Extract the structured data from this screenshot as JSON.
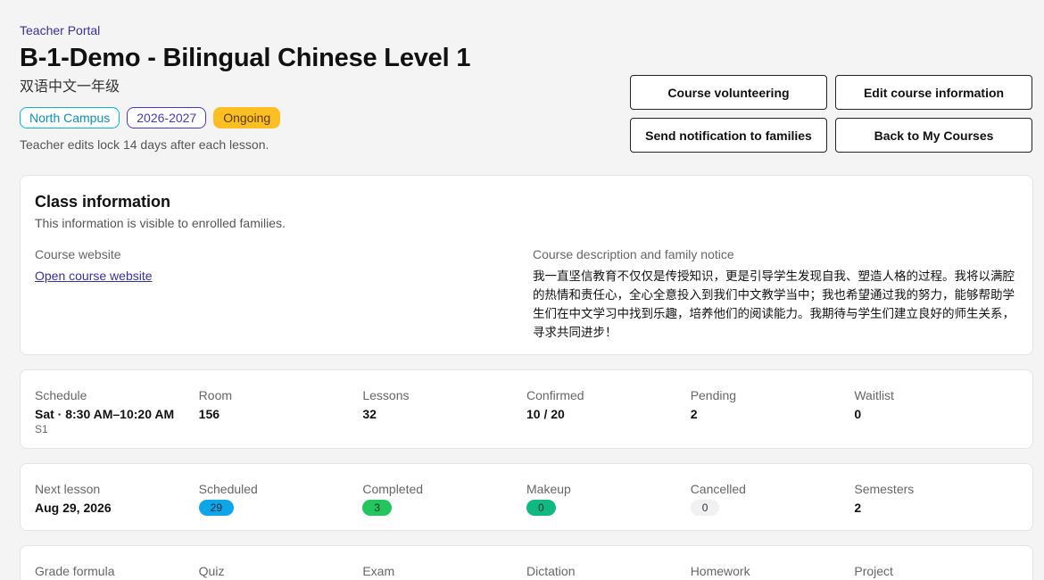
{
  "header": {
    "portal_label": "Teacher Portal",
    "title": "B-1-Demo - Bilingual Chinese Level 1",
    "subtitle": "双语中文一年级",
    "badges": {
      "campus": "North Campus",
      "year": "2026-2027",
      "status": "Ongoing"
    },
    "lock_note": "Teacher edits lock 14 days after each lesson."
  },
  "actions": {
    "volunteering": "Course volunteering",
    "edit_info": "Edit course information",
    "notify_families": "Send notification to families",
    "back": "Back to My Courses"
  },
  "class_info": {
    "title": "Class information",
    "subtitle": "This information is visible to enrolled families.",
    "website_label": "Course website",
    "website_link": "Open course website",
    "description_label": "Course description and family notice",
    "description": "我一直坚信教育不仅仅是传授知识，更是引导学生发现自我、塑造人格的过程。我将以满腔的热情和责任心，全心全意投入到我们中文教学当中；我也希望通过我的努力，能够帮助学生们在中文学习中找到乐趣，培养他们的阅读能力。我期待与学生们建立良好的师生关系，寻求共同进步！"
  },
  "schedule": {
    "schedule_label": "Schedule",
    "schedule_value": "Sat · 8:30 AM–10:20 AM",
    "schedule_extra": "S1",
    "room_label": "Room",
    "room_value": "156",
    "lessons_label": "Lessons",
    "lessons_value": "32",
    "confirmed_label": "Confirmed",
    "confirmed_value": "10 / 20",
    "pending_label": "Pending",
    "pending_value": "2",
    "waitlist_label": "Waitlist",
    "waitlist_value": "0"
  },
  "lessons": {
    "next_label": "Next lesson",
    "next_value": "Aug 29, 2026",
    "scheduled_label": "Scheduled",
    "scheduled_value": "29",
    "completed_label": "Completed",
    "completed_value": "3",
    "makeup_label": "Makeup",
    "makeup_value": "0",
    "cancelled_label": "Cancelled",
    "cancelled_value": "0",
    "semesters_label": "Semesters",
    "semesters_value": "2"
  },
  "grade": {
    "formula_label": "Grade formula",
    "quiz_label": "Quiz",
    "exam_label": "Exam",
    "dictation_label": "Dictation",
    "homework_label": "Homework",
    "project_label": "Project"
  },
  "colors": {
    "accent": "#3730a3",
    "campus": "#06b6d4",
    "status": "#fbbf24",
    "scheduled": "#0ea5e9",
    "completed": "#22c55e",
    "makeup": "#10b981"
  }
}
